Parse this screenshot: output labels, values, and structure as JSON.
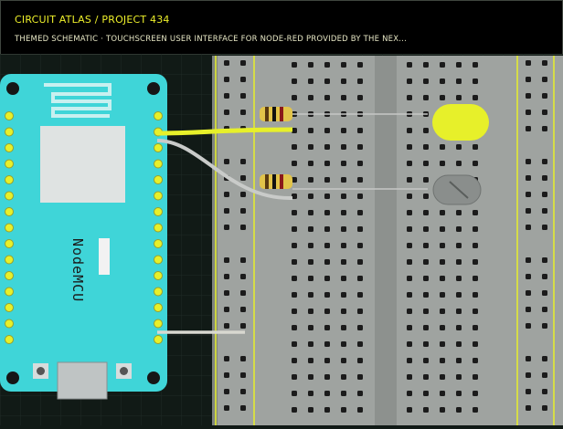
{
  "header": {
    "breadcrumb": "CIRCUIT ATLAS / PROJECT 434",
    "subtitle": "THEMED SCHEMATIC · TOUCHSCREEN USER INTERFACE FOR NODE-RED PROVIDED BY THE NEX..."
  },
  "board": {
    "label": "NodeMCU",
    "color": "#3fd5d8"
  },
  "components": {
    "led_color": "#e7f02a",
    "wire_color": "#e7f02a",
    "resistor_color": "#e2c44a"
  },
  "palette": {
    "background": "#111a16",
    "breadboard": "#9fa3a0",
    "rail_line": "#e7f02a"
  }
}
